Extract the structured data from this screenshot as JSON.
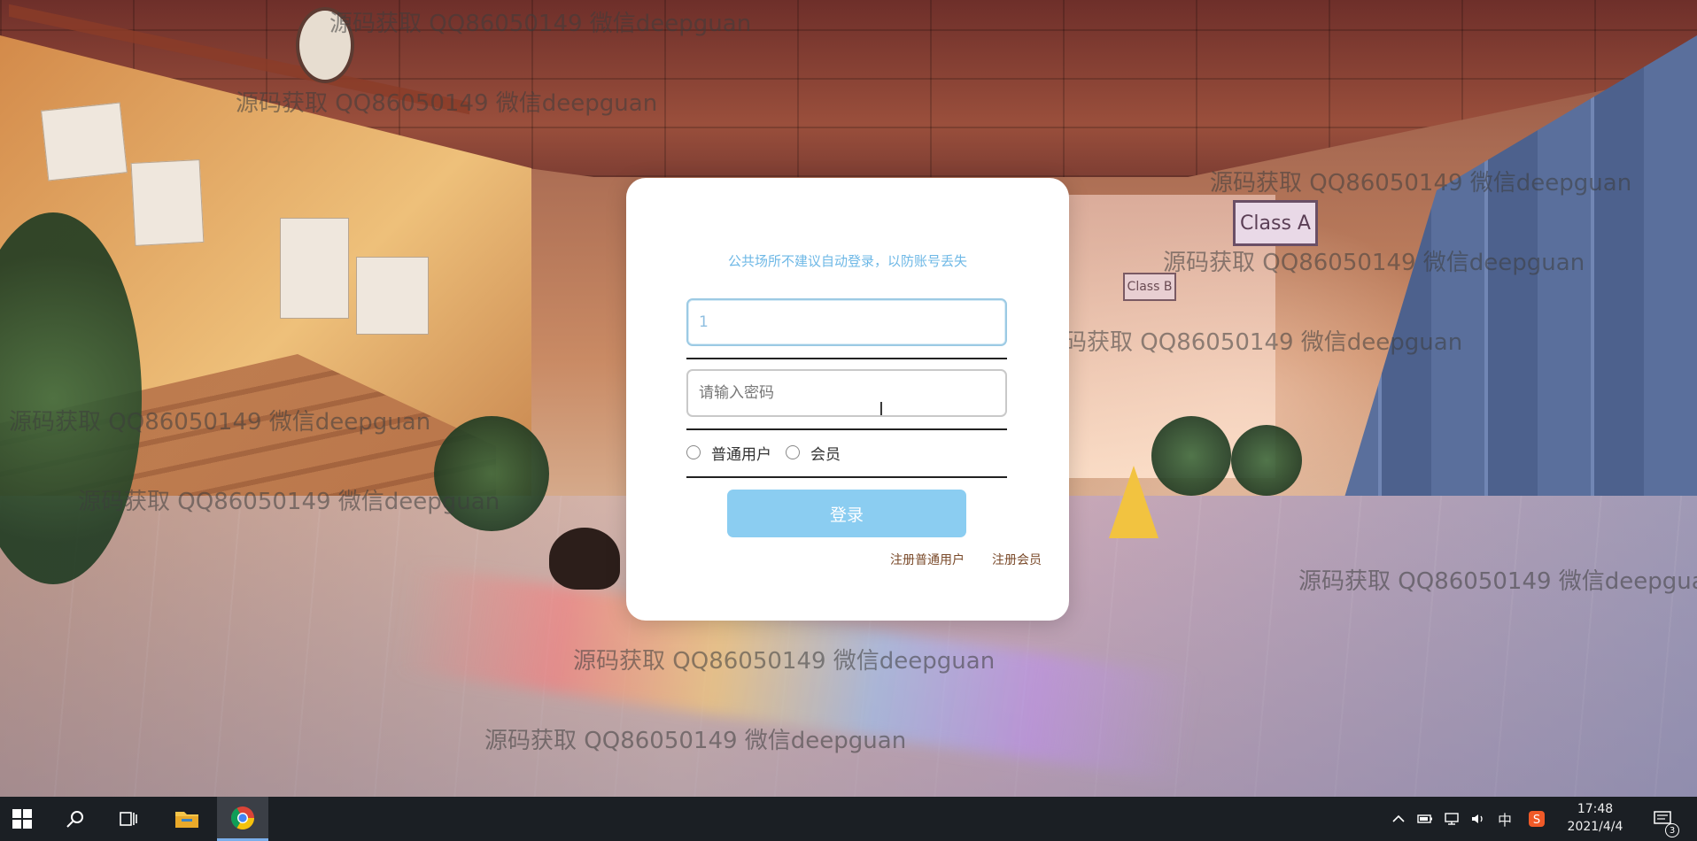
{
  "login": {
    "tip": "公共场所不建议自动登录，以防账号丢失",
    "username_value": "1",
    "password_placeholder": "请输入密码",
    "roles": [
      "普通用户",
      "会员"
    ],
    "login_button": "登录",
    "register_user": "注册普通用户",
    "register_member": "注册会员"
  },
  "watermark": "源码获取 QQ86050149 微信deepguan",
  "scene": {
    "sign_a": "Class A",
    "sign_b": "Class B"
  },
  "taskbar": {
    "icons": [
      "windows-start-icon",
      "search-icon",
      "task-view-icon",
      "file-explorer-icon",
      "chrome-icon"
    ],
    "tray": [
      "chevron-up-icon",
      "battery-icon",
      "network-icon",
      "volume-icon"
    ],
    "ime": "中",
    "time": "17:48",
    "date": "2021/4/4",
    "notifications": "3"
  },
  "colors": {
    "card_bg": "#ffffff",
    "button": "#8bcdf1",
    "tip": "#6eb8e6",
    "register_link": "#7a4a2a",
    "taskbar": "#1b1f24"
  }
}
